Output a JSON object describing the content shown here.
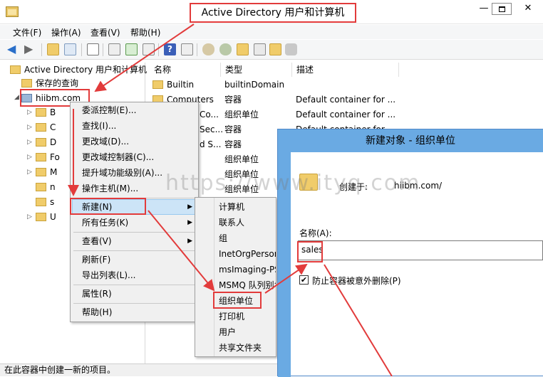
{
  "window": {
    "title": "Active Directory 用户和计算机",
    "minimize": "—",
    "maximize": "□",
    "close": "✕"
  },
  "menubar": [
    "文件(F)",
    "操作(A)",
    "查看(V)",
    "帮助(H)"
  ],
  "tree": {
    "root": "Active Directory 用户和计算机",
    "saved_queries": "保存的查询",
    "domain": "hiibm.com",
    "children_partial": [
      "B",
      "C",
      "D",
      "Fo",
      "M",
      "n",
      "s",
      "U"
    ]
  },
  "list": {
    "columns": [
      "名称",
      "类型",
      "描述"
    ],
    "rows": [
      {
        "name": "Builtin",
        "type": "builtinDomain",
        "desc": ""
      },
      {
        "name": "Computers",
        "type": "容器",
        "desc": "Default container for ..."
      },
      {
        "name": "Co...",
        "type": "组织单位",
        "desc": "Default container for ..."
      },
      {
        "name": "Sec...",
        "type": "容器",
        "desc": "Default container for ..."
      },
      {
        "name": "d S...",
        "type": "容器",
        "desc": ""
      },
      {
        "name": "",
        "type": "组织单位",
        "desc": ""
      },
      {
        "name": "",
        "type": "组织单位",
        "desc": ""
      },
      {
        "name": "",
        "type": "组织单位",
        "desc": ""
      }
    ]
  },
  "context_menu": {
    "items": [
      "委派控制(E)...",
      "查找(I)...",
      "更改域(D)...",
      "更改域控制器(C)...",
      "提升域功能级别(A)...",
      "操作主机(M)...",
      "新建(N)",
      "所有任务(K)",
      "查看(V)",
      "刷新(F)",
      "导出列表(L)...",
      "属性(R)",
      "帮助(H)"
    ]
  },
  "submenu": {
    "items": [
      "计算机",
      "联系人",
      "组",
      "InetOrgPerson",
      "msImaging-PSPs",
      "MSMQ 队列别名",
      "组织单位",
      "打印机",
      "用户",
      "共享文件夹"
    ]
  },
  "dialog": {
    "title": "新建对象 - 组织单位",
    "create_in_label": "创建于:",
    "create_in_value": "hiibm.com/",
    "name_label": "名称(A):",
    "name_value": "sales",
    "protect_checkbox": "防止容器被意外删除(P)",
    "protect_checked": true
  },
  "statusbar": "在此容器中创建一新的项目。",
  "watermark": "https://www.ityq.com",
  "colors": {
    "highlight": "#e23b3b",
    "dialog_title": "#6aaae3",
    "menu_hover": "#cce4f7"
  }
}
